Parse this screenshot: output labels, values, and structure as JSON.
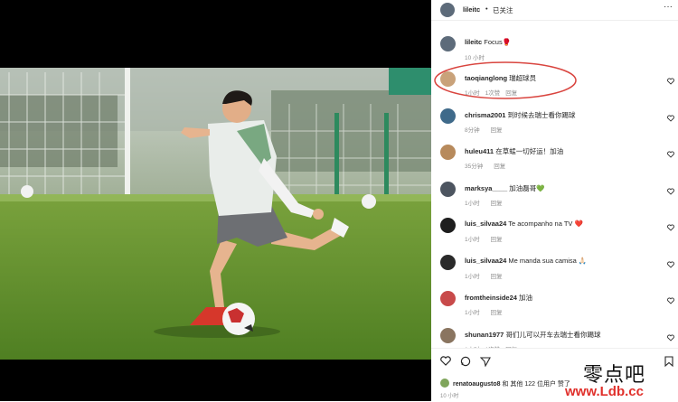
{
  "post": {
    "author": "lileitc",
    "separator": "•",
    "follow_status": "已关注"
  },
  "caption": {
    "author": "lileitc",
    "text": "Focus🥊",
    "time": "10 小时"
  },
  "comments": [
    {
      "user": "taoqianglong",
      "text": "瑞超球员",
      "time": "1小时",
      "likes": "1次赞",
      "reply": "回复"
    },
    {
      "user": "chrisma2001",
      "text": "到时候去瑞士看你踢球",
      "time": "8分钟",
      "likes": "",
      "reply": "回复"
    },
    {
      "user": "huleu411",
      "text": "在草蜢一切好运！加油",
      "time": "35分钟",
      "likes": "",
      "reply": "回复"
    },
    {
      "user": "marksya____",
      "text": "加油磊哥💚",
      "time": "1小时",
      "likes": "",
      "reply": "回复"
    },
    {
      "user": "luis_silvaa24",
      "text": "Te acompanho na TV ❤️",
      "time": "1小时",
      "likes": "",
      "reply": "回复"
    },
    {
      "user": "luis_silvaa24",
      "text": "Me manda sua camisa 🙏🏻",
      "time": "1小时",
      "likes": "",
      "reply": "回复"
    },
    {
      "user": "fromtheinside24",
      "text": "加油",
      "time": "1小时",
      "likes": "",
      "reply": "回复"
    },
    {
      "user": "shunan1977",
      "text": "哥们儿可以开车去瑞士看你踢球",
      "time": "1小时",
      "likes": "1次赞",
      "reply": "回复"
    }
  ],
  "likes_line": {
    "user": "renatoaugusto8",
    "text": "和 其他 122 位用户 赞了"
  },
  "post_time": "10 小时",
  "watermark": {
    "cn": "零点吧",
    "url": "www.Ldb.cc"
  },
  "colors": {
    "highlight_circle": "#d9453f",
    "text": "#262626",
    "meta": "#8e8e8e"
  }
}
